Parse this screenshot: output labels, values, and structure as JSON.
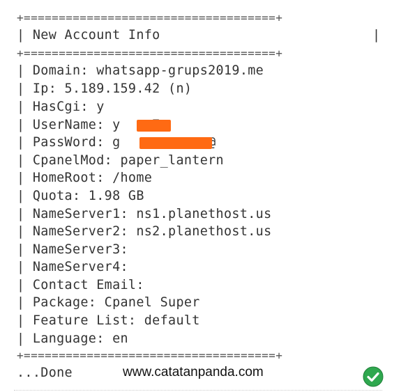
{
  "terminal": {
    "border": "+====================================+",
    "header_title": "| New Account Info",
    "header_right_pipe": "|",
    "lines": [
      "| Domain: whatsapp-grups2019.me",
      "| Ip: 5.189.159.42 (n)",
      "| HasCgi: y",
      "| UserName: y    7",
      "| PassWord: g          o@",
      "| CpanelMod: paper_lantern",
      "| HomeRoot: /home",
      "| Quota: 1.98 GB",
      "| NameServer1: ns1.planethost.us",
      "| NameServer2: ns2.planethost.us",
      "| NameServer3:",
      "| NameServer4:",
      "| Contact Email:",
      "| Package: Cpanel Super",
      "| Feature List: default",
      "| Language: en"
    ],
    "done": "...Done"
  },
  "watermark": "www.catatanpanda.com",
  "icons": {
    "check": "check-circle-icon"
  },
  "colors": {
    "text": "#333333",
    "redaction": "#ff6a13",
    "check": "#2fa84f"
  }
}
